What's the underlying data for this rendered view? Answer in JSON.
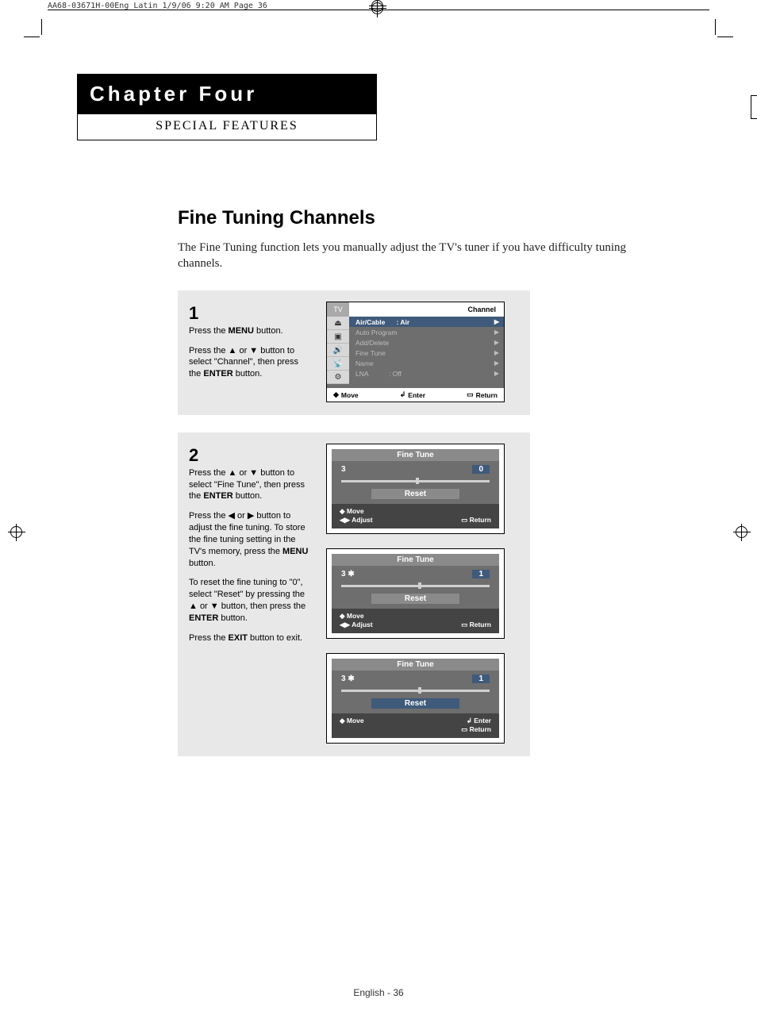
{
  "header_strip": "AA68-03671H-00Eng_Latin  1/9/06  9:20 AM  Page 36",
  "chapter": {
    "title": "Chapter Four",
    "subtitle": "SPECIAL FEATURES"
  },
  "section": {
    "title": "Fine Tuning Channels",
    "intro": "The Fine Tuning function lets you manually adjust the TV's tuner if you have difficulty tuning channels."
  },
  "step1": {
    "num": "1",
    "p1a": "Press the ",
    "p1b": "MENU",
    "p1c": " button.",
    "p2a": "Press the ▲ or ▼ button to select \"Channel\", then press the ",
    "p2b": "ENTER",
    "p2c": " button."
  },
  "step2": {
    "num": "2",
    "p1a": "Press the ▲ or ▼ button to select \"Fine Tune\", then press the ",
    "p1b": "ENTER",
    "p1c": " button.",
    "p2a": "Press the ◀ or ▶ button to adjust the fine tuning. To store the fine tuning setting in the TV's memory, press the ",
    "p2b": "MENU",
    "p2c": " button.",
    "p3a": "To reset the fine tuning to \"0\", select \"Reset\" by pressing the ▲ or ▼ button, then press the ",
    "p3b": "ENTER",
    "p3c": " button.",
    "p4a": "Press the ",
    "p4b": "EXIT",
    "p4c": " button to exit."
  },
  "osd1": {
    "tab_left": "TV",
    "tab_right": "Channel",
    "rows": [
      {
        "label": "Air/Cable",
        "value": ":  Air",
        "hl": true
      },
      {
        "label": "Auto Program",
        "value": "",
        "hl": false
      },
      {
        "label": "Add/Delete",
        "value": "",
        "hl": false
      },
      {
        "label": "Fine Tune",
        "value": "",
        "hl": false
      },
      {
        "label": "Name",
        "value": "",
        "hl": false
      },
      {
        "label": "LNA",
        "value": ":  Off",
        "hl": false
      }
    ],
    "footer": {
      "move": "Move",
      "enter": "Enter",
      "return": "Return"
    }
  },
  "ft_a": {
    "title": "Fine Tune",
    "ch": "3",
    "val": "0",
    "thumb_pct": 50,
    "reset": "Reset",
    "foot": {
      "move": "Move",
      "adjust": "Adjust",
      "return": "Return"
    }
  },
  "ft_b": {
    "title": "Fine Tune",
    "ch": "3 ✱",
    "val": "1",
    "thumb_pct": 52,
    "reset": "Reset",
    "foot": {
      "move": "Move",
      "adjust": "Adjust",
      "return": "Return"
    }
  },
  "ft_c": {
    "title": "Fine Tune",
    "ch": "3 ✱",
    "val": "1",
    "thumb_pct": 52,
    "reset": "Reset",
    "foot": {
      "move": "Move",
      "enter": "Enter",
      "return": "Return"
    }
  },
  "page_num": "English - 36"
}
